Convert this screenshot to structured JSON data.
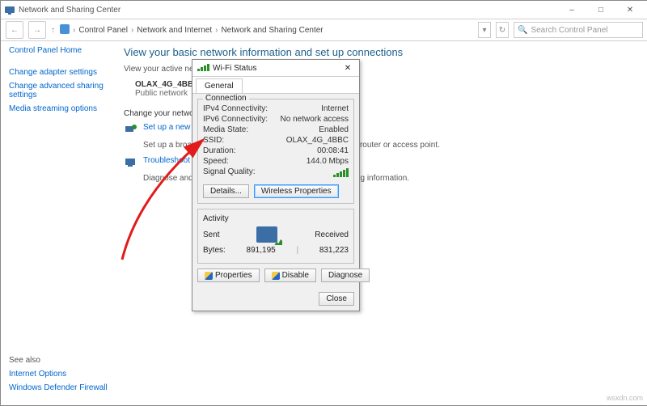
{
  "window": {
    "title": "Network and Sharing Center",
    "breadcrumb": [
      "Control Panel",
      "Network and Internet",
      "Network and Sharing Center"
    ],
    "search_placeholder": "Search Control Panel"
  },
  "sidebar": {
    "home": "Control Panel Home",
    "links": [
      "Change adapter settings",
      "Change advanced sharing settings",
      "Media streaming options"
    ],
    "see_also_title": "See also",
    "see_also": [
      "Internet Options",
      "Windows Defender Firewall"
    ]
  },
  "content": {
    "page_title": "View your basic network information and set up connections",
    "active_heading": "View your active networks",
    "network_name": "OLAX_4G_4BBC 2",
    "network_type": "Public network",
    "settings_heading": "Change your networking settings",
    "setup_link": "Set up a new connection or network",
    "setup_desc": "Set up a broadband, dial-up, or VPN connection; or set up a router or access point.",
    "troubleshoot_link": "Troubleshoot problems",
    "troubleshoot_desc": "Diagnose and repair network problems, or get troubleshooting information."
  },
  "dialog": {
    "title": "Wi-Fi Status",
    "tab": "General",
    "group_conn": "Connection",
    "rows": {
      "ipv4_k": "IPv4 Connectivity:",
      "ipv4_v": "Internet",
      "ipv6_k": "IPv6 Connectivity:",
      "ipv6_v": "No network access",
      "media_k": "Media State:",
      "media_v": "Enabled",
      "ssid_k": "SSID:",
      "ssid_v": "OLAX_4G_4BBC",
      "dur_k": "Duration:",
      "dur_v": "00:08:41",
      "speed_k": "Speed:",
      "speed_v": "144.0 Mbps",
      "sig_k": "Signal Quality:"
    },
    "buttons": {
      "details": "Details...",
      "wireless_props": "Wireless Properties",
      "properties": "Properties",
      "disable": "Disable",
      "diagnose": "Diagnose",
      "close": "Close"
    },
    "activity": {
      "title": "Activity",
      "sent_label": "Sent",
      "recv_label": "Received",
      "bytes_label": "Bytes:",
      "sent_bytes": "891,195",
      "recv_bytes": "831,223"
    }
  },
  "watermark": "wsxdn.com"
}
